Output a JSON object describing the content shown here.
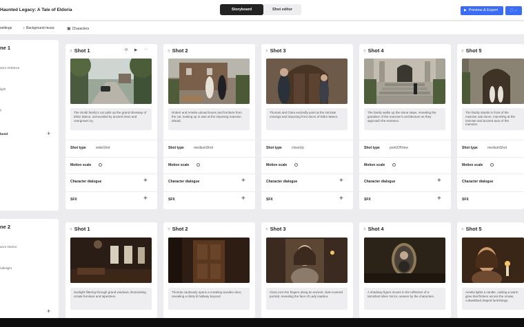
{
  "header": {
    "project_title": "Haunted Legacy: A Tale of Eldoria",
    "mode_tabs": [
      "Storyboard",
      "Shot editor"
    ],
    "export_label": "Preview & Export",
    "share_icon": "briefcase-icon"
  },
  "toolbar": {
    "items": [
      {
        "label": "settings",
        "icon": "gear-icon"
      },
      {
        "label": "Background music",
        "icon": "music-note-icon"
      },
      {
        "label": "Characters",
        "icon": "person-icon"
      }
    ]
  },
  "scenes": [
    {
      "title": "ne 1",
      "fields": [
        "anor entrance",
        "light",
        "y"
      ],
      "add_label": "bund",
      "shots": [
        {
          "name": "Shot 1",
          "description": "The Smith family's car pulls up the grand driveway of Eldor Manor, surrounded by ancient trees and overgrown ivy.",
          "shot_type": "wideShot"
        },
        {
          "name": "Shot 2",
          "description": "Robert and Amelia unload boxes and furniture from the car, looking up in awe at the imposing mansion ahead.",
          "shot_type": "mediumShot"
        },
        {
          "name": "Shot 3",
          "description": "Thomas and Clara excitedly point at the intricate carvings and imposing front doors of Eldor Manor.",
          "shot_type": "closeUp"
        },
        {
          "name": "Shot 4",
          "description": "The family walks up the stone steps, revealing the grandeur of the mansion's architecture as they approach the entrance.",
          "shot_type": "pointOfView"
        },
        {
          "name": "Shot 5",
          "description": "The family stands in front of the massive oak doors, marveling at the intricate and ancient aura of the mansion.",
          "shot_type": "mediumShot"
        }
      ]
    },
    {
      "title": "ne 2",
      "fields": [
        "anor interior",
        "ndlelight"
      ],
      "add_label": "",
      "shots": [
        {
          "name": "Shot 1",
          "description": "Sunlight filtering through grand windows, illuminating ornate furniture and tapestries."
        },
        {
          "name": "Shot 2",
          "description": "Thomas cautiously opens a creaking wooden door, revealing a dimly lit hallway beyond."
        },
        {
          "name": "Shot 3",
          "description": "Clara runs her fingers along an ancient, dust-covered portrait, revealing the face of Lady Isadora."
        },
        {
          "name": "Shot 4",
          "description": "A shadowy figure moves in the reflection of a tarnished silver mirror, unseen by the characters."
        },
        {
          "name": "Shot 5",
          "description": "Amelia lights a candle, casting a warm glow that flickers across the ornate, cobwebbed draped furnishings."
        }
      ]
    }
  ],
  "labels": {
    "shot_type": "Shot type",
    "motion_scale": "Motion scale",
    "character_dialogue": "Character dialogue",
    "sfx": "SFX"
  },
  "colors": {
    "accent": "#3b6cf5",
    "active_tab": "#222222"
  }
}
